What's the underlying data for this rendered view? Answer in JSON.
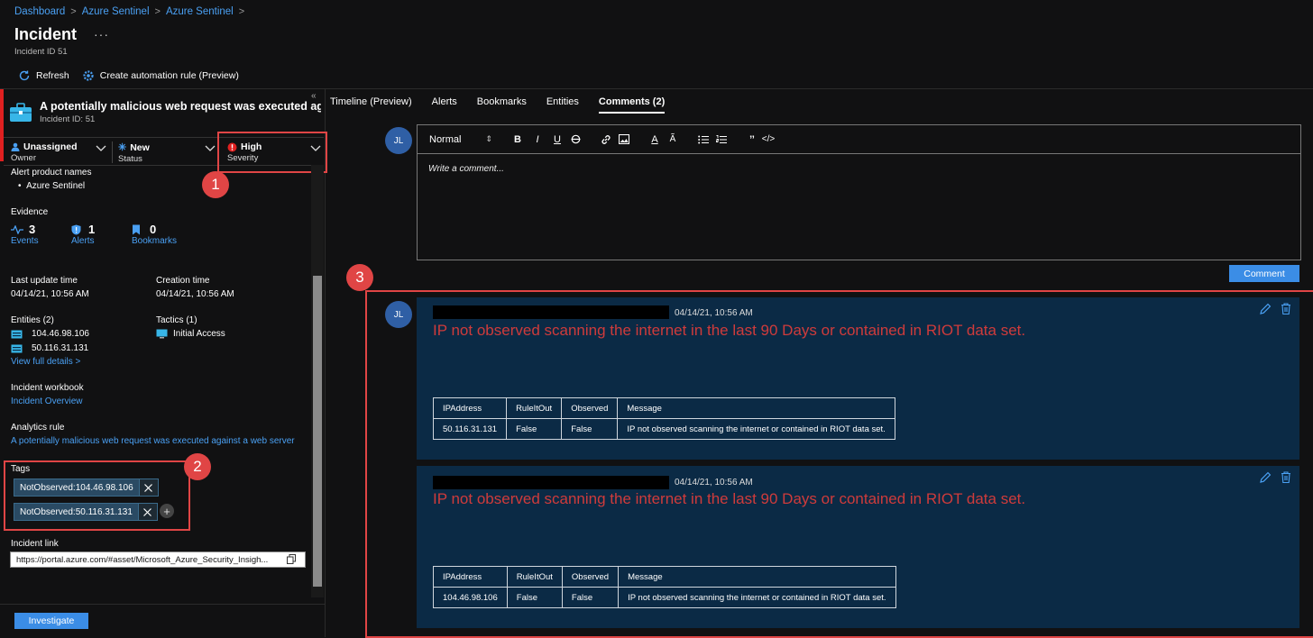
{
  "breadcrumb": [
    "Dashboard",
    "Azure Sentinel",
    "Azure Sentinel"
  ],
  "page": {
    "title": "Incident",
    "more": "···",
    "subtitle": "Incident ID 51"
  },
  "toolbar": {
    "refresh": "Refresh",
    "automation": "Create automation rule (Preview)"
  },
  "incident": {
    "title": "A potentially malicious web request was executed ag...",
    "id_label": "Incident ID: 51",
    "owner": {
      "value": "Unassigned",
      "label": "Owner"
    },
    "status": {
      "value": "New",
      "label": "Status"
    },
    "severity": {
      "value": "High",
      "label": "Severity"
    },
    "alert_product_names_label": "Alert product names",
    "alert_products": [
      "Azure Sentinel"
    ],
    "evidence_label": "Evidence",
    "evidence": [
      {
        "count": "3",
        "label": "Events"
      },
      {
        "count": "1",
        "label": "Alerts"
      },
      {
        "count": "0",
        "label": "Bookmarks"
      }
    ],
    "last_update_label": "Last update time",
    "last_update": "04/14/21, 10:56 AM",
    "creation_label": "Creation time",
    "creation": "04/14/21, 10:56 AM",
    "entities_label": "Entities (2)",
    "entities": [
      "104.46.98.106",
      "50.116.31.131"
    ],
    "view_details": "View full details >",
    "tactics_label": "Tactics (1)",
    "tactics": [
      "Initial Access"
    ],
    "workbook_label": "Incident workbook",
    "workbook_link": "Incident Overview",
    "analytics_label": "Analytics rule",
    "analytics_link": "A potentially malicious web request was executed against a web server",
    "tags_label": "Tags",
    "tags": [
      "NotObserved:104.46.98.106",
      "NotObserved:50.116.31.131"
    ],
    "link_label": "Incident link",
    "link_value": "https://portal.azure.com/#asset/Microsoft_Azure_Security_Insigh...",
    "investigate": "Investigate"
  },
  "annotations": [
    "1",
    "2",
    "3"
  ],
  "tabs": [
    "Timeline (Preview)",
    "Alerts",
    "Bookmarks",
    "Entities",
    "Comments (2)"
  ],
  "editor": {
    "avatar": "JL",
    "style_select": "Normal",
    "placeholder": "Write a comment...",
    "submit": "Comment"
  },
  "comments": [
    {
      "avatar": "JL",
      "time": "04/14/21, 10:56 AM",
      "text": "IP not observed scanning the internet in the last 90 Days or contained in RIOT data set.",
      "table_headers": [
        "IPAddress",
        "RuleItOut",
        "Observed",
        "Message"
      ],
      "table_row": [
        "50.116.31.131",
        "False",
        "False",
        "IP not observed scanning the internet or contained in RIOT data set."
      ]
    },
    {
      "time": "04/14/21, 10:56 AM",
      "text": "IP not observed scanning the internet in the last 90 Days or contained in RIOT data set.",
      "table_headers": [
        "IPAddress",
        "RuleItOut",
        "Observed",
        "Message"
      ],
      "table_row": [
        "104.46.98.106",
        "False",
        "False",
        "IP not observed scanning the internet or contained in RIOT data set."
      ]
    }
  ],
  "colors": {
    "accent": "#4aa0f3",
    "highlight": "#e04545",
    "card": "#0b2a45",
    "comment_text": "#cf3b3b"
  }
}
